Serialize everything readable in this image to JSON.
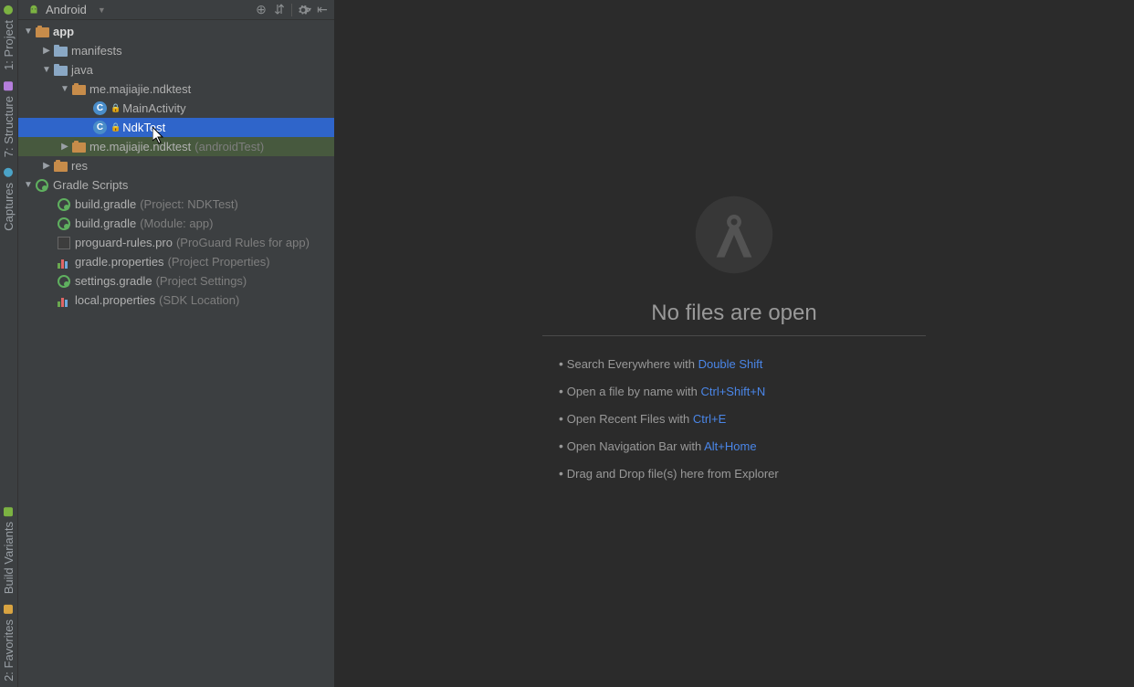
{
  "left_stripe": {
    "top": [
      {
        "label": "1: Project"
      },
      {
        "label": "7: Structure"
      },
      {
        "label": "Captures"
      }
    ],
    "bottom": [
      {
        "label": "Build Variants"
      },
      {
        "label": "2: Favorites"
      }
    ]
  },
  "panel": {
    "view_label": "Android",
    "tools": {
      "target": "⊕",
      "sync": "⇵",
      "gear": "✻",
      "hide": "⇤"
    }
  },
  "tree": {
    "app": {
      "label": "app",
      "expanded": true
    },
    "manifests": {
      "label": "manifests"
    },
    "java": {
      "label": "java",
      "expanded": true
    },
    "pkg_main": {
      "label": "me.majiajie.ndktest",
      "expanded": true
    },
    "main_activity": {
      "label": "MainActivity"
    },
    "ndk_test": {
      "label": "NdkTest"
    },
    "pkg_test": {
      "label": "me.majiajie.ndktest",
      "suffix": "(androidTest)"
    },
    "res": {
      "label": "res"
    },
    "gradle_scripts": {
      "label": "Gradle Scripts",
      "expanded": true
    },
    "bg_project": {
      "label": "build.gradle",
      "suffix": "(Project: NDKTest)"
    },
    "bg_module": {
      "label": "build.gradle",
      "suffix": "(Module: app)"
    },
    "proguard": {
      "label": "proguard-rules.pro",
      "suffix": "(ProGuard Rules for app)"
    },
    "gp": {
      "label": "gradle.properties",
      "suffix": "(Project Properties)"
    },
    "sg": {
      "label": "settings.gradle",
      "suffix": "(Project Settings)"
    },
    "lp": {
      "label": "local.properties",
      "suffix": "(SDK Location)"
    }
  },
  "editor": {
    "title": "No files are open",
    "tips": [
      {
        "text": "Search Everywhere with ",
        "key": "Double Shift"
      },
      {
        "text": "Open a file by name with ",
        "key": "Ctrl+Shift+N"
      },
      {
        "text": "Open Recent Files with ",
        "key": "Ctrl+E"
      },
      {
        "text": "Open Navigation Bar with ",
        "key": "Alt+Home"
      },
      {
        "text": "Drag and Drop file(s) here from Explorer",
        "key": ""
      }
    ]
  }
}
